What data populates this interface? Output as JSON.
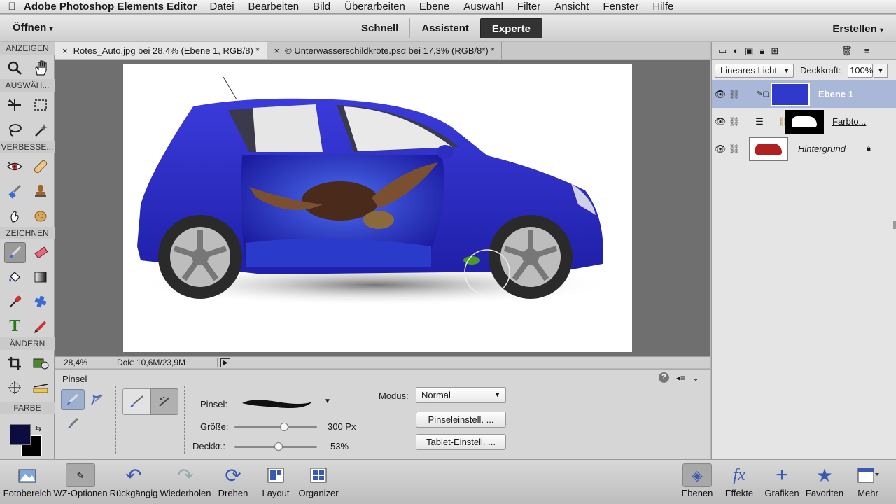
{
  "menubar": {
    "app_name": "Adobe Photoshop Elements Editor",
    "items": [
      "Datei",
      "Bearbeiten",
      "Bild",
      "Überarbeiten",
      "Ebene",
      "Auswahl",
      "Filter",
      "Ansicht",
      "Fenster",
      "Hilfe"
    ]
  },
  "modebar": {
    "open_label": "Öffnen",
    "modes": [
      "Schnell",
      "Assistent",
      "Experte"
    ],
    "active_mode": "Experte",
    "create_label": "Erstellen"
  },
  "toolbox": {
    "sections": [
      "ANZEIGEN",
      "AUSWÄH...",
      "VERBESSE...",
      "ZEICHNEN",
      "ÄNDERN",
      "FARBE"
    ],
    "foreground_color": "#0c0c40",
    "background_color": "#000000"
  },
  "doc_tabs": [
    {
      "label": "Rotes_Auto.jpg bei 28,4% (Ebene 1, RGB/8) *",
      "close": "×"
    },
    {
      "label": "© Unterwasserschildkröte.psd bei 17,3% (RGB/8*) *",
      "close": "×"
    }
  ],
  "statusbar": {
    "zoom": "28,4%",
    "doc_info": "Dok: 10,6M/23,9M"
  },
  "options": {
    "title": "Pinsel",
    "brush_label": "Pinsel:",
    "size_label": "Größe:",
    "size_value": "300 Px",
    "size_percent": 0.6,
    "opacity_label": "Deckkr.:",
    "opacity_value": "53%",
    "opacity_percent": 0.53,
    "mode_label": "Modus:",
    "mode_value": "Normal",
    "brush_settings": "Pinseleinstell. ...",
    "tablet_settings": "Tablet-Einstell. ..."
  },
  "layers_panel": {
    "blend_mode": "Lineares Licht",
    "opacity_label": "Deckkraft:",
    "opacity_value": "100%",
    "layers": [
      {
        "name": "Ebene 1",
        "selected": true
      },
      {
        "name": "Farbto...",
        "selected": false
      },
      {
        "name": "Hintergrund",
        "selected": false
      }
    ]
  },
  "bottombar": {
    "left": [
      "Fotobereich",
      "WZ-Optionen",
      "Rückgängig",
      "Wiederholen",
      "Drehen",
      "Layout",
      "Organizer"
    ],
    "right": [
      "Ebenen",
      "Effekte",
      "Grafiken",
      "Favoriten",
      "Mehr"
    ]
  }
}
